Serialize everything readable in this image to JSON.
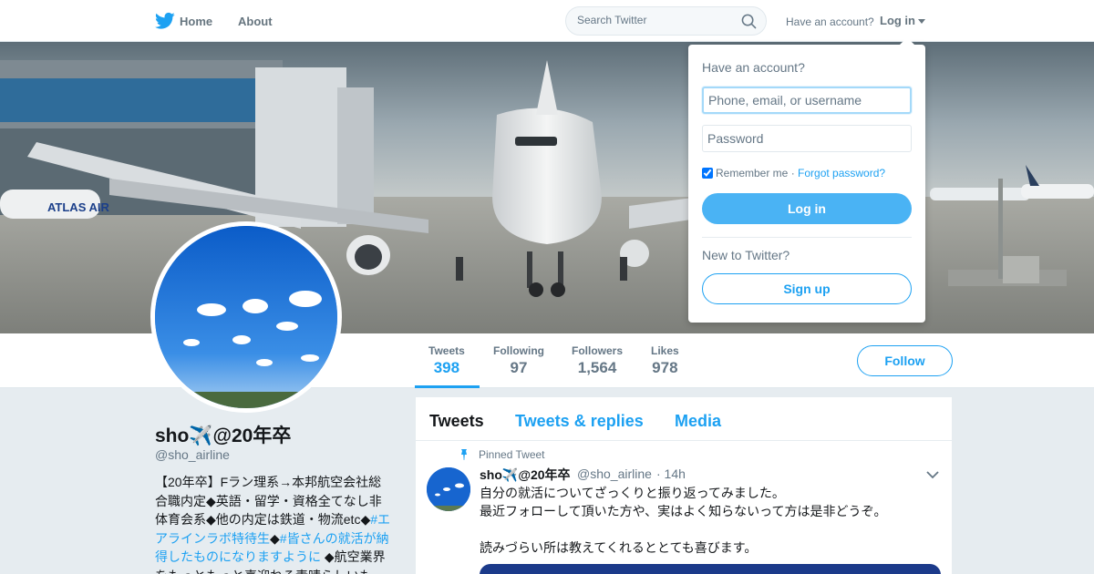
{
  "nav": {
    "home_label": "Home",
    "about_label": "About",
    "search_placeholder": "Search Twitter",
    "have_account": "Have an account?",
    "login_label": "Log in"
  },
  "banner": {
    "plane_livery": "ATLAS AIR"
  },
  "stats": [
    {
      "label": "Tweets",
      "value": "398"
    },
    {
      "label": "Following",
      "value": "97"
    },
    {
      "label": "Followers",
      "value": "1,564"
    },
    {
      "label": "Likes",
      "value": "978"
    }
  ],
  "follow_label": "Follow",
  "profile": {
    "name": "sho✈️@20年卒",
    "handle": "@sho_airline",
    "bio_part1": "【20年卒】Fラン理系→本邦航空会社総合職内定◆英語・留学・資格全てなし非体育会系◆他の内定は鉄道・物流etc◆",
    "bio_link": "#エアラインラボ特待生",
    "bio_part2": "◆",
    "bio_link2": "#皆さんの就活が納得したものになりますように",
    "bio_part3": " ◆航空業界をもっともっと喜迎ねる素晴らしいも"
  },
  "timeline": {
    "tabs": [
      "Tweets",
      "Tweets & replies",
      "Media"
    ],
    "pinned_label": "Pinned Tweet",
    "tweet": {
      "name": "sho✈️@20年卒",
      "handle": "@sho_airline",
      "time": "· 14h",
      "line1": "自分の就活についてざっくりと振り返ってみました。",
      "line2": "最近フォローして頂いた方や、実はよく知らないって方は是非どうぞ。",
      "line3": "読みづらい所は教えてくれるととても喜びます。"
    }
  },
  "login_dropdown": {
    "title": "Have an account?",
    "username_placeholder": "Phone, email, or username",
    "password_placeholder": "Password",
    "remember_label": "Remember me",
    "separator": " · ",
    "forgot_label": "Forgot password?",
    "login_button": "Log in",
    "new_label": "New to Twitter?",
    "signup_button": "Sign up"
  },
  "colors": {
    "accent": "#1da1f2",
    "login_button": "#4ab3f4",
    "background": "#e6ecf0"
  }
}
